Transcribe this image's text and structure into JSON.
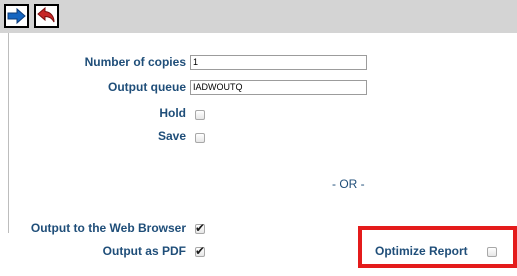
{
  "toolbar": {
    "forward_icon": "arrow-right-icon",
    "back_icon": "return-arrow-icon",
    "accent_color": "#1565c0",
    "back_color": "#c62828"
  },
  "form": {
    "copies": {
      "label": "Number of copies",
      "value": "1"
    },
    "queue": {
      "label": "Output queue",
      "value": "IADWOUTQ"
    },
    "hold": {
      "label": "Hold",
      "checked": false
    },
    "save": {
      "label": "Save",
      "checked": false
    },
    "separator": "- OR -",
    "web_browser": {
      "label": "Output to the Web Browser",
      "checked": true
    },
    "pdf": {
      "label": "Output as PDF",
      "checked": true
    },
    "optimize": {
      "label": "Optimize Report",
      "checked": false
    }
  },
  "colors": {
    "label": "#1f4e79",
    "highlight": "#e41b1b",
    "toolbar_bg": "#d4d4d4"
  }
}
